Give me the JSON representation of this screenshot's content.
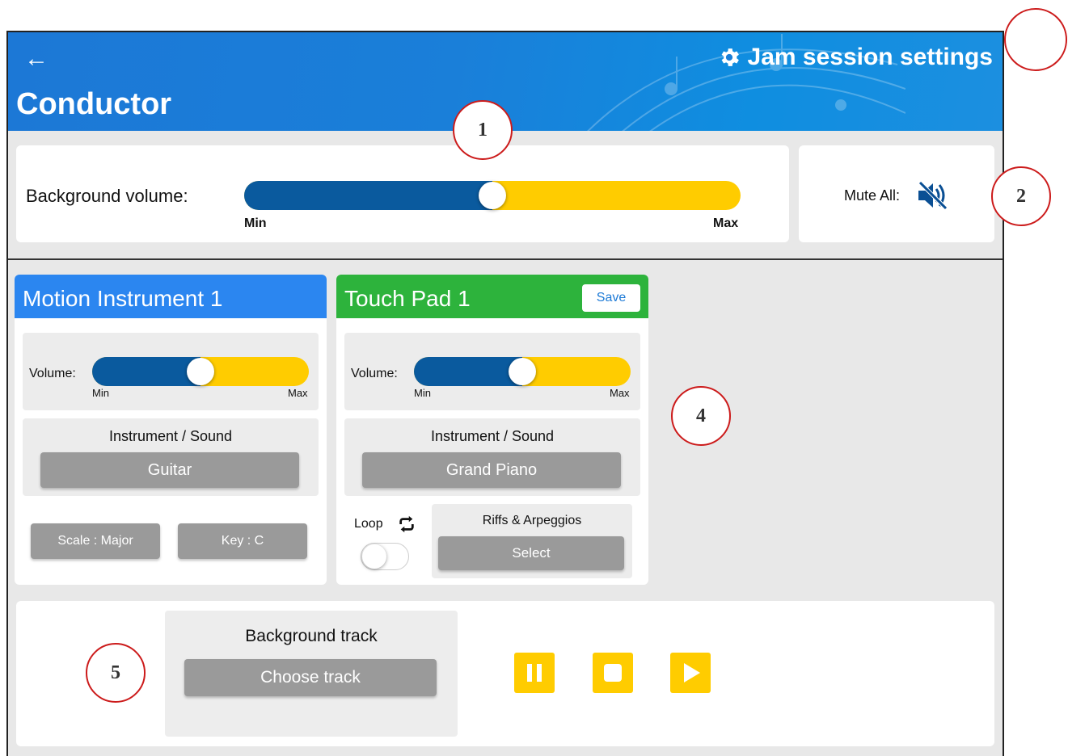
{
  "header": {
    "back_icon": "←",
    "title": "Conductor",
    "settings_label": "Jam session settings",
    "settings_icon": "gear-icon"
  },
  "background_volume": {
    "label": "Background volume:",
    "min_label": "Min",
    "max_label": "Max",
    "value_fraction": 0.5
  },
  "mute": {
    "label": "Mute All:",
    "icon": "speaker-muted-icon"
  },
  "cards": [
    {
      "title": "Motion Instrument 1",
      "color": "#2b86f0",
      "volume_label": "Volume:",
      "volume_min": "Min",
      "volume_max": "Max",
      "volume_fraction": 0.5,
      "instrument_label": "Instrument / Sound",
      "instrument_value": "Guitar",
      "scale_label": "Scale : Major",
      "key_label": "Key : C"
    },
    {
      "title": "Touch Pad 1",
      "color": "#2db33c",
      "save_label": "Save",
      "volume_label": "Volume:",
      "volume_min": "Min",
      "volume_max": "Max",
      "volume_fraction": 0.5,
      "instrument_label": "Instrument / Sound",
      "instrument_value": "Grand Piano",
      "loop_label": "Loop",
      "loop_on": false,
      "riffs_label": "Riffs & Arpeggios",
      "riffs_button": "Select"
    }
  ],
  "background_track": {
    "label": "Background track",
    "choose_label": "Choose track",
    "controls": [
      "pause-icon",
      "stop-icon",
      "play-icon"
    ]
  },
  "annotations": [
    "1",
    "2",
    "4",
    "5"
  ],
  "colors": {
    "accent_yellow": "#ffcc00",
    "slider_blue": "#0a5a9e",
    "annotation_red": "#cc1b1b"
  }
}
